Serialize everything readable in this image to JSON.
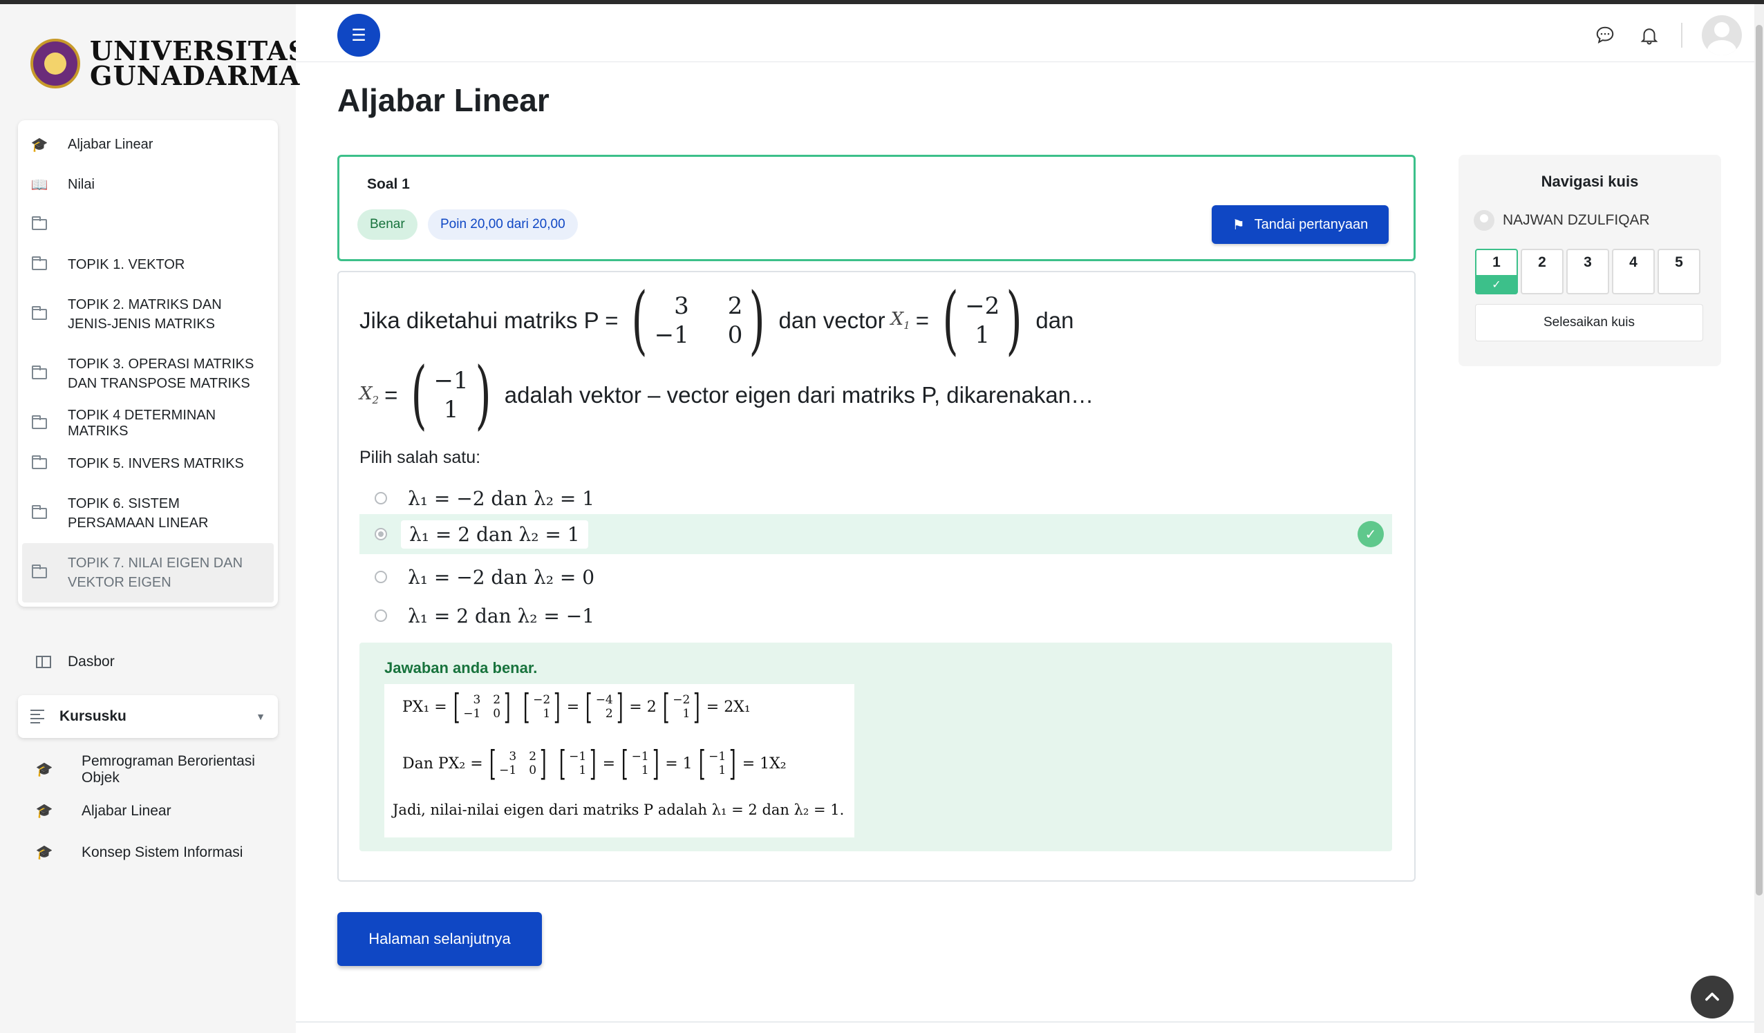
{
  "brand": {
    "name_line1": "UNIVERSITAS",
    "name_line2": "GUNADARMA"
  },
  "course_nav": [
    {
      "label": "Aljabar Linear",
      "icon": "graduation-cap-icon"
    },
    {
      "label": "Nilai",
      "icon": "book-icon"
    },
    {
      "label": "",
      "icon": "folder-icon"
    },
    {
      "label": "TOPIK 1. VEKTOR",
      "icon": "folder-icon"
    },
    {
      "label": "TOPIK 2. MATRIKS DAN JENIS-JENIS MATRIKS",
      "icon": "folder-icon"
    },
    {
      "label": "TOPIK 3. OPERASI MATRIKS DAN TRANSPOSE MATRIKS",
      "icon": "folder-icon"
    },
    {
      "label": "TOPIK 4 DETERMINAN MATRIKS",
      "icon": "folder-icon"
    },
    {
      "label": "TOPIK 5. INVERS MATRIKS",
      "icon": "folder-icon"
    },
    {
      "label": "TOPIK 6. SISTEM PERSAMAAN LINEAR",
      "icon": "folder-icon"
    },
    {
      "label": "TOPIK 7. NILAI EIGEN DAN VEKTOR EIGEN",
      "icon": "folder-icon"
    }
  ],
  "dasbor": "Dasbor",
  "kursusku": {
    "label": "Kursusku",
    "courses": [
      "Pemrograman Berorientasi Objek",
      "Aljabar Linear",
      "Konsep Sistem Informasi"
    ]
  },
  "page_title": "Aljabar Linear",
  "question": {
    "number": "Soal 1",
    "status": "Benar",
    "points": "Poin 20,00 dari 20,00",
    "flag_label": "Tandai pertanyaan",
    "text_a": "Jika diketahui matriks P =",
    "matrix_p": [
      "3",
      "2",
      "−1",
      "0"
    ],
    "text_b": "dan vector",
    "x1_label": "X",
    "x1_sub": "1",
    "vector_x1": [
      "−2",
      "1"
    ],
    "text_c": "dan",
    "x2_label": "X",
    "x2_sub": "2",
    "vector_x2": [
      "−1",
      "1"
    ],
    "text_d": "adalah vektor – vector eigen dari matriks P, dikarenakan…",
    "eq": "=",
    "prompt": "Pilih salah satu:",
    "options": [
      "λ₁ = −2 dan λ₂ = 1",
      "λ₁ = 2 dan λ₂ = 1",
      "λ₁ = −2 dan λ₂ = 0",
      "λ₁ = 2 dan λ₂ = −1"
    ],
    "selected_index": 1,
    "feedback_title": "Jawaban anda benar.",
    "feedback": {
      "r1_lhs": "PX₁ =",
      "m1": [
        "3",
        "2",
        "−1",
        "0"
      ],
      "v1": [
        "−2",
        "1"
      ],
      "r1_eq1": "=",
      "r1_res": [
        "−4",
        "2"
      ],
      "r1_eq2": "= 2",
      "r1_v": [
        "−2",
        "1"
      ],
      "r1_end": "= 2X₁",
      "r2_lhs": "Dan PX₂ =",
      "m2": [
        "3",
        "2",
        "−1",
        "0"
      ],
      "v2": [
        "−1",
        "1"
      ],
      "r2_eq1": "=",
      "r2_res": [
        "−1",
        "1"
      ],
      "r2_eq2": "= 1",
      "r2_v": [
        "−1",
        "1"
      ],
      "r2_end": "= 1X₂",
      "conclusion": "Jadi, nilai-nilai eigen dari matriks P adalah λ₁ = 2 dan λ₂ = 1."
    }
  },
  "next_button": "Halaman selanjutnya",
  "quiz_nav": {
    "title": "Navigasi kuis",
    "user": "NAJWAN DZULFIQAR",
    "numbers": [
      "1",
      "2",
      "3",
      "4",
      "5"
    ],
    "answered": [
      true,
      false,
      false,
      false,
      false
    ],
    "finish_label": "Selesaikan kuis"
  },
  "colors": {
    "primary": "#0f47c4",
    "success": "#3cc08a",
    "success_bg": "#e6f5ed"
  }
}
